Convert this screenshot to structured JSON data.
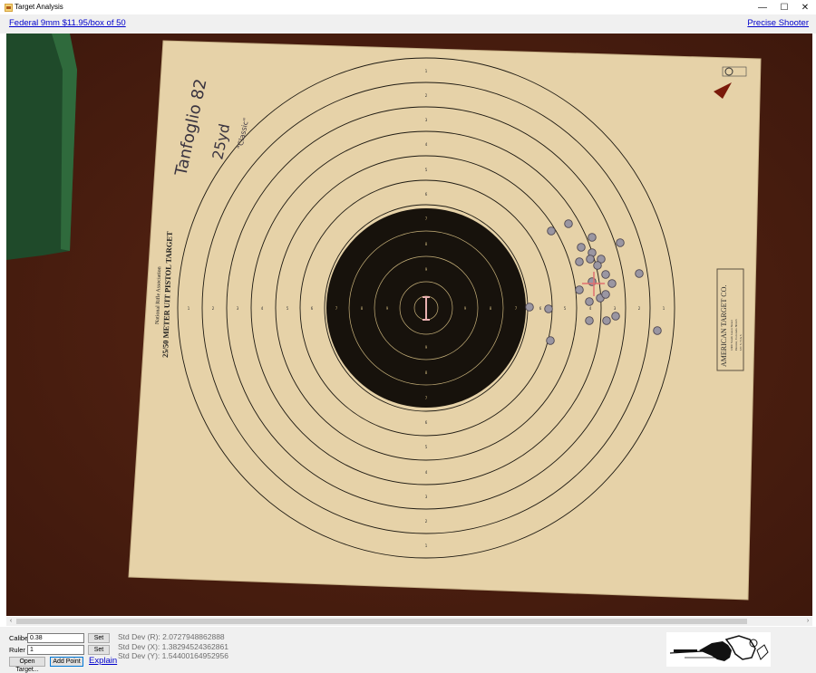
{
  "window": {
    "title": "Target Analysis",
    "controls": {
      "minimize": "—",
      "maximize": "☐",
      "close": "✕"
    }
  },
  "links": {
    "ammo": "Federal 9mm $11.95/box of 50",
    "brand": "Precise Shooter"
  },
  "target": {
    "handwriting": [
      "Tanfoglio 82",
      "25yd",
      "\"Classic\""
    ],
    "side_print": [
      "National Rifle Association",
      "25/50 METER UIT PISTOL TARGET"
    ],
    "maker_print": [
      "AMERICAN TARGET CO.",
      "1300 South Jason Street",
      "Denver, Colorado 80223",
      "UC 5 / CA 5"
    ],
    "ring_numbers": [
      "1",
      "2",
      "3",
      "4",
      "5",
      "6",
      "7",
      "8",
      "9"
    ],
    "colors": {
      "paper": "#e6d2a8",
      "black": "#17120c",
      "table": "#4a1e10",
      "shot": "#9a96a2",
      "ring_line": "#1e1a12",
      "inner_ring": "#c8b27a"
    }
  },
  "controls": {
    "caliber_label": "Caliber",
    "caliber_value": "0.38",
    "ruler_label": "Ruler",
    "ruler_value": "1",
    "set_label": "Set",
    "open_target": "Open Target...",
    "add_point": "Add Point",
    "explain": "Explain"
  },
  "stats": {
    "std_r": "Std Dev (R): 2.0727948862888",
    "std_x": "Std Dev (X): 1.38294524362861",
    "std_y": "Std Dev (Y): 1.54400164952956"
  }
}
